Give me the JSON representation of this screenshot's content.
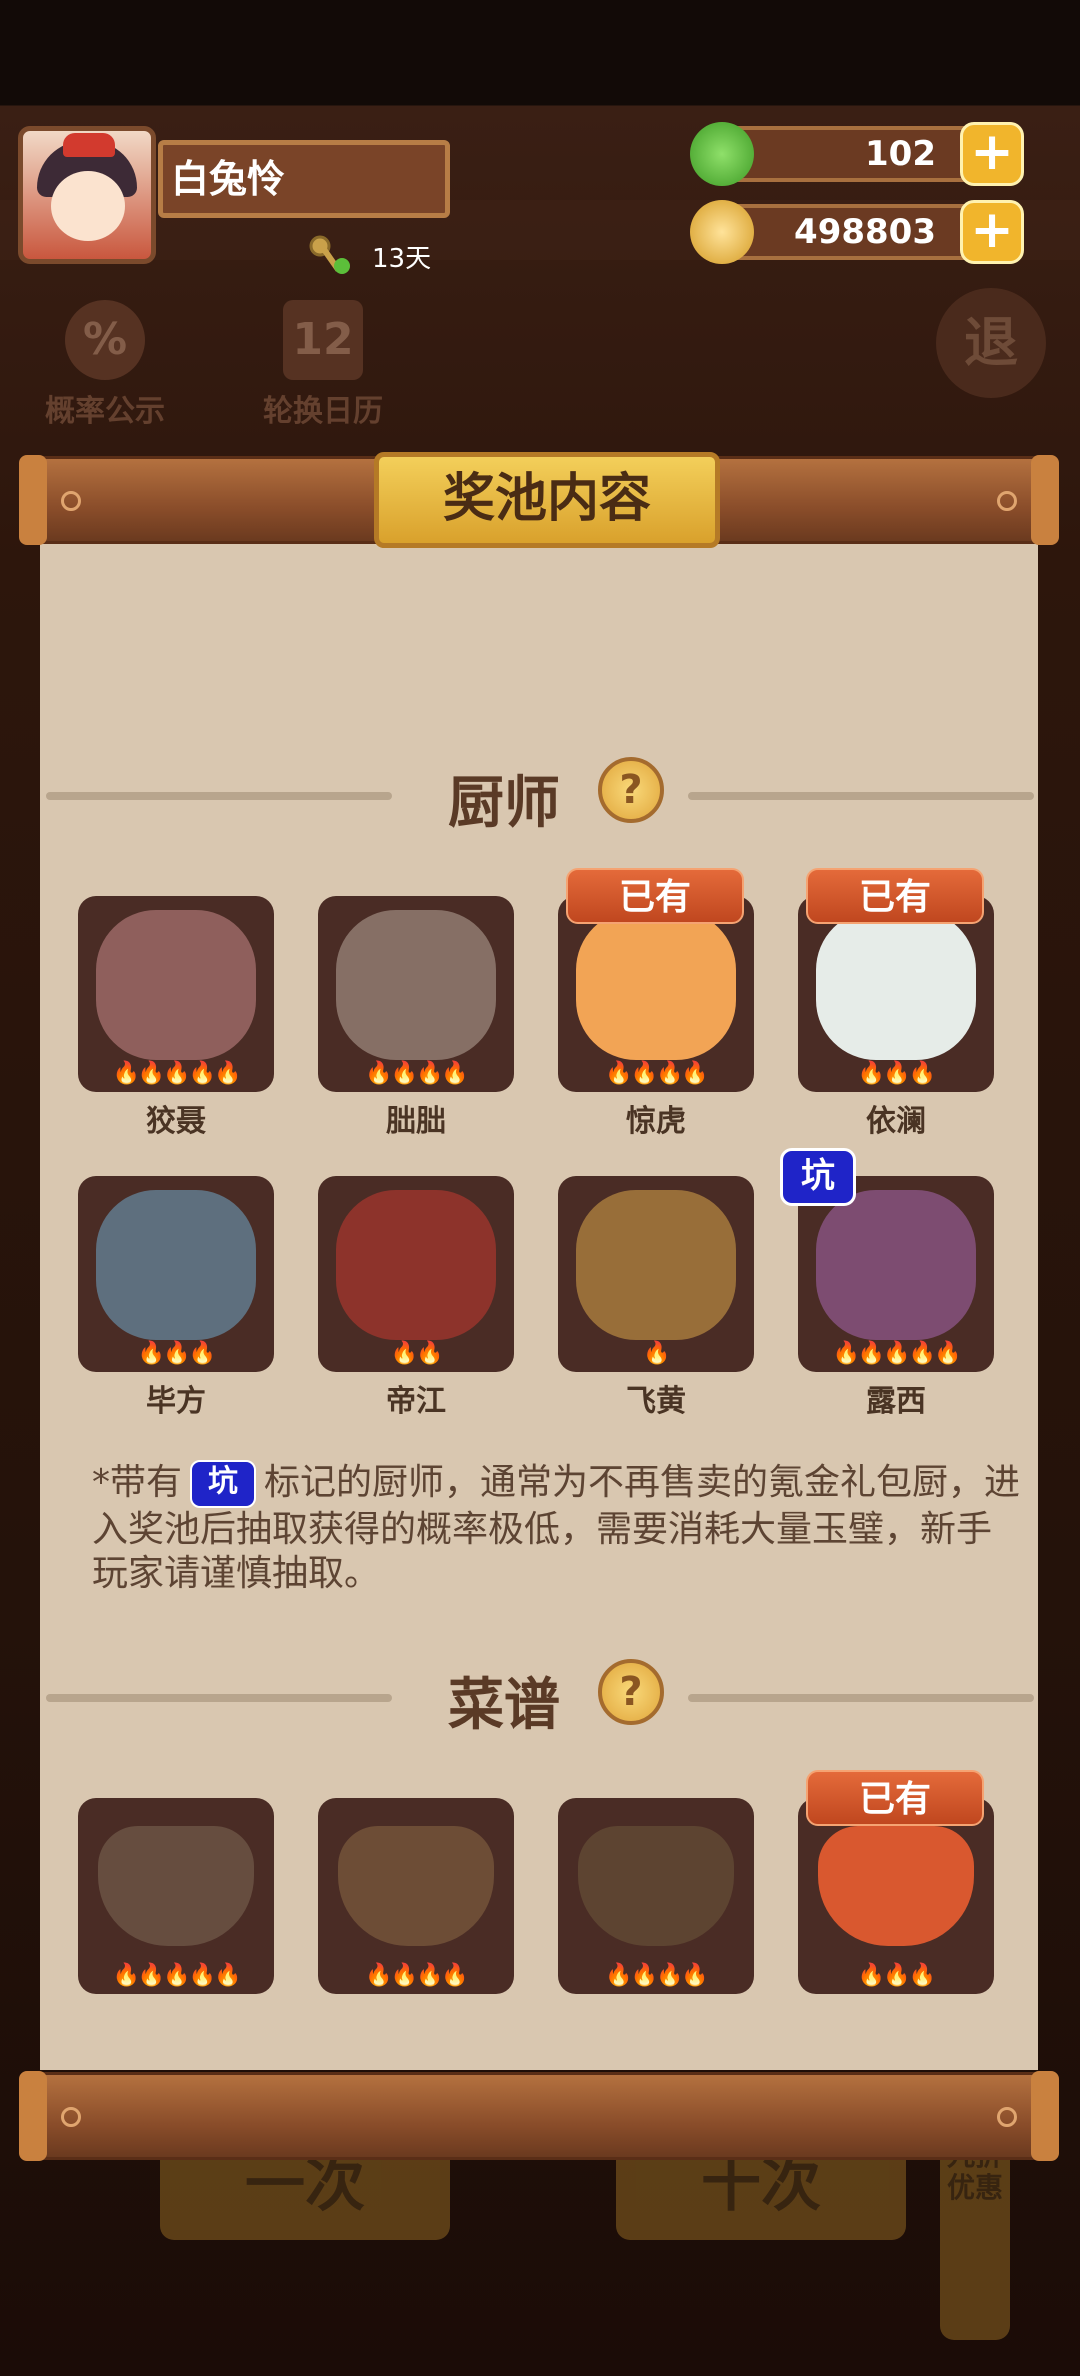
{
  "player": {
    "name": "白兔怜",
    "days": "13天"
  },
  "resources": [
    {
      "icon": "jade-icon",
      "value": "102",
      "color": "#5cbf3a"
    },
    {
      "icon": "coin-icon",
      "value": "498803",
      "color": "#e3b23a"
    }
  ],
  "side_buttons": {
    "probability": "概率公示",
    "calendar": "轮换日历",
    "calendar_day": "12",
    "exit": "退"
  },
  "bottom": {
    "single": "一次",
    "ten": "十次",
    "discount": "九折优惠"
  },
  "panel": {
    "title": "奖池内容"
  },
  "chefs": {
    "title": "厨师",
    "help": "?",
    "owned_label": "已有",
    "pit_label": "坑",
    "items": [
      {
        "name": "狡聂",
        "stars": 5,
        "owned": false,
        "pit": false,
        "color": "#c98b8b"
      },
      {
        "name": "朏朏",
        "stars": 4,
        "owned": false,
        "pit": false,
        "color": "#b8a89a"
      },
      {
        "name": "惊虎",
        "stars": 4,
        "owned": true,
        "pit": false,
        "color": "#f2a455"
      },
      {
        "name": "依澜",
        "stars": 3,
        "owned": true,
        "pit": false,
        "color": "#e6ece8"
      },
      {
        "name": "毕方",
        "stars": 3,
        "owned": false,
        "pit": false,
        "color": "#6fa7c9"
      },
      {
        "name": "帝江",
        "stars": 2,
        "owned": false,
        "pit": false,
        "color": "#c43a32"
      },
      {
        "name": "飞黄",
        "stars": 1,
        "owned": false,
        "pit": false,
        "color": "#d9a54a"
      },
      {
        "name": "露西",
        "stars": 5,
        "owned": false,
        "pit": true,
        "color": "#a868b0"
      }
    ],
    "note_pre": "*带有",
    "note_post": "标记的厨师，通常为不再售卖的氪金礼包厨，进入奖池后抽取获得的概率极低，需要消耗大量玉璧，新手玩家请谨慎抽取。"
  },
  "recipes": {
    "title": "菜谱",
    "help": "?",
    "owned_label": "已有",
    "items": [
      {
        "stars": 5,
        "owned": false,
        "color": "#7e6a55"
      },
      {
        "stars": 4,
        "owned": false,
        "color": "#8a6a45"
      },
      {
        "stars": 4,
        "owned": false,
        "color": "#6e5a3c"
      },
      {
        "stars": 3,
        "owned": true,
        "color": "#d9582f"
      }
    ]
  }
}
